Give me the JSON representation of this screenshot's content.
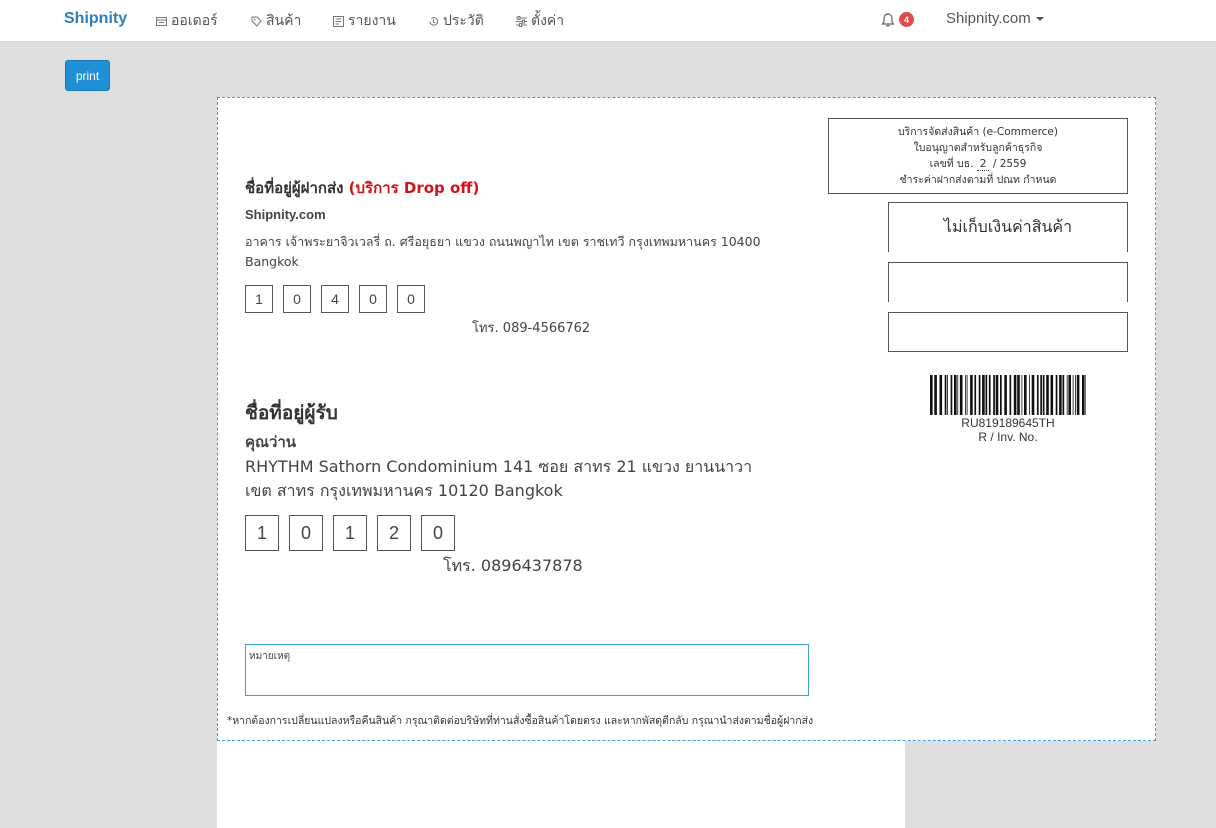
{
  "navbar": {
    "brand": "Shipnity",
    "items": [
      {
        "label": "ออเดอร์",
        "icon": "orders-icon"
      },
      {
        "label": "สินค้า",
        "icon": "tag-icon"
      },
      {
        "label": "รายงาน",
        "icon": "report-icon"
      },
      {
        "label": "ประวัติ",
        "icon": "history-icon"
      },
      {
        "label": "ตั้งค่า",
        "icon": "settings-sliders-icon"
      }
    ],
    "notification_count": "4",
    "account": "Shipnity.com"
  },
  "toolbar": {
    "print_label": "print"
  },
  "label": {
    "sender": {
      "title": "ชื่อที่อยู่ผู้ฝากส่ง",
      "service": "(บริการ Drop off)",
      "name": "Shipnity.com",
      "address_line1": "อาคาร เจ้าพระยาจิวเวลรี่ ถ. ศรีอยุธยา แขวง ถนนพญาไท เขต ราชเทวี กรุงเทพมหานคร 10400",
      "address_line2": "Bangkok",
      "zip": [
        "1",
        "0",
        "4",
        "0",
        "0"
      ],
      "phone": "โทร. 089-4566762"
    },
    "receiver": {
      "title": "ชื่อที่อยู่ผู้รับ",
      "name": "คุณว่าน",
      "address_line1": "RHYTHM Sathorn Condominium 141 ซอย สาทร 21 แขวง ยานนาวา",
      "address_line2": "เขต สาทร กรุงเทพมหานคร 10120 Bangkok",
      "zip": [
        "1",
        "0",
        "1",
        "2",
        "0"
      ],
      "phone": "โทร. 0896437878"
    },
    "permit": {
      "line1": "บริการจัดส่งสินค้า (e-Commerce)",
      "line2": "ใบอนุญาตสำหรับลูกค้าธุรกิจ",
      "line3_prefix": "เลขที่ บธ.",
      "line3_number": "2",
      "line3_suffix": "/ 2559",
      "line4": "ชำระค่าฝากส่งตามที่ ปณท กำหนด"
    },
    "cod_text": "ไม่เก็บเงินค่าสินค้า",
    "tracking_number": "RU819189645TH",
    "tracking_caption": "R / Inv. No.",
    "note_label": "หมายเหตุ",
    "footnote": "*หากต้องการเปลี่ยนแปลงหรือคืนสินค้า กรุณาติดต่อบริษัทที่ท่านสั่งซื้อสินค้าโดยตรง และหากพัสดุตีกลับ กรุณานำส่งตามชื่อผู้ฝากส่ง"
  },
  "colors": {
    "accent": "#2f7fb8",
    "print_button": "#1f8fd6",
    "drop_off_red": "#d0121b",
    "badge": "#e24b4b",
    "label_border": "#3aa0d8"
  }
}
